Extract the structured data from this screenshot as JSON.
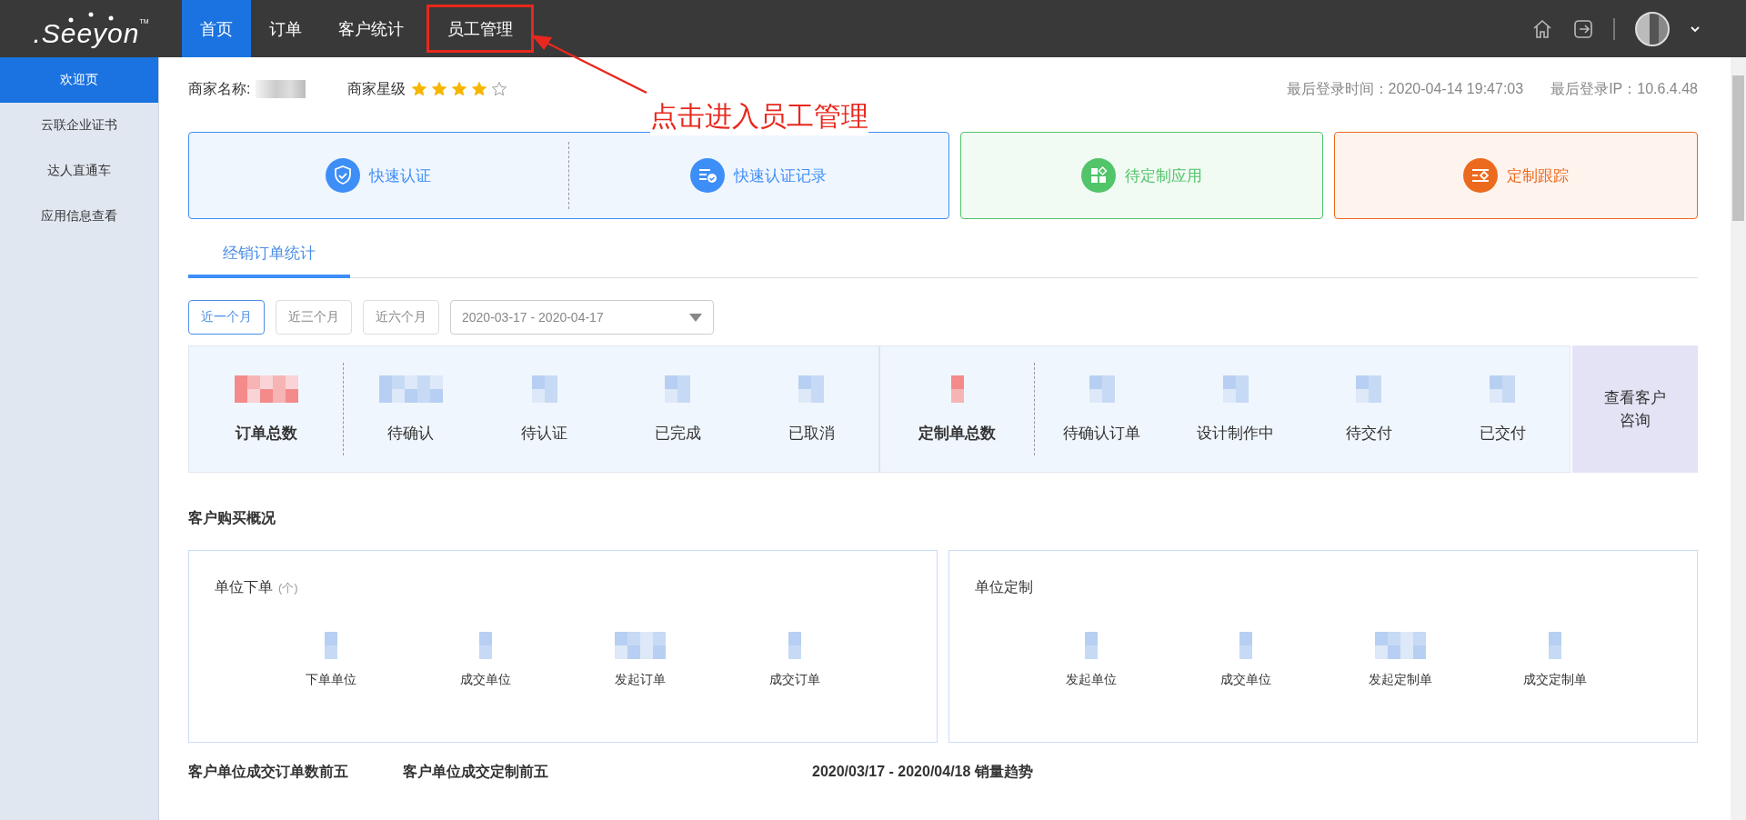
{
  "logo": {
    "text": ".Seeyon",
    "mark": "TM"
  },
  "nav": [
    {
      "label": "首页",
      "selected": true,
      "highlighted": false
    },
    {
      "label": "订单",
      "selected": false,
      "highlighted": false
    },
    {
      "label": "客户统计",
      "selected": false,
      "highlighted": false
    },
    {
      "label": "员工管理",
      "selected": false,
      "highlighted": true
    }
  ],
  "annotation": {
    "text": "点击进入员工管理"
  },
  "sidebar": [
    {
      "label": "欢迎页",
      "selected": true
    },
    {
      "label": "云联企业证书",
      "selected": false
    },
    {
      "label": "达人直通车",
      "selected": false
    },
    {
      "label": "应用信息查看",
      "selected": false
    }
  ],
  "merchant": {
    "name_label": "商家名称:",
    "rating_label": "商家星级",
    "stars": 4,
    "last_login": "最后登录时间：2020-04-14 19:47:03",
    "last_ip": "最后登录IP：10.6.4.48"
  },
  "quick_cards": [
    {
      "color": "#3e8ef7",
      "actions": [
        {
          "label": "快速认证",
          "kind": "shield"
        },
        {
          "label": "快速认证记录",
          "kind": "record"
        }
      ]
    },
    {
      "color": "#52c46a",
      "actions": [
        {
          "label": "待定制应用",
          "kind": "apps"
        }
      ]
    },
    {
      "color": "#ec6a1e",
      "actions": [
        {
          "label": "定制跟踪",
          "kind": "track"
        }
      ]
    }
  ],
  "tabs": [
    {
      "label": "经销订单统计",
      "selected": true
    }
  ],
  "range_buttons": [
    {
      "label": "近一个月",
      "selected": true
    },
    {
      "label": "近三个月",
      "selected": false
    },
    {
      "label": "近六个月",
      "selected": false
    }
  ],
  "date_range": {
    "value": "2020-03-17 - 2020-04-17"
  },
  "stats_groups": [
    {
      "total_label": "订单总数",
      "items": [
        "待确认",
        "待认证",
        "已完成",
        "已取消"
      ]
    },
    {
      "total_label": "定制单总数",
      "items": [
        "待确认订单",
        "设计制作中",
        "待交付",
        "已交付"
      ]
    }
  ],
  "consult_button": {
    "label": "查看客户咨询"
  },
  "section_title": "客户购买概况",
  "panels": [
    {
      "title": "单位下单",
      "unit": "(个)",
      "metrics": [
        "下单单位",
        "成交单位",
        "发起订单",
        "成交订单"
      ]
    },
    {
      "title": "单位定制",
      "metrics": [
        "发起单位",
        "成交单位",
        "发起定制单",
        "成交定制单"
      ]
    }
  ],
  "bottom_titles": [
    "客户单位成交订单数前五",
    "客户单位成交定制前五",
    "2020/03/17 - 2020/04/18 销量趋势"
  ]
}
